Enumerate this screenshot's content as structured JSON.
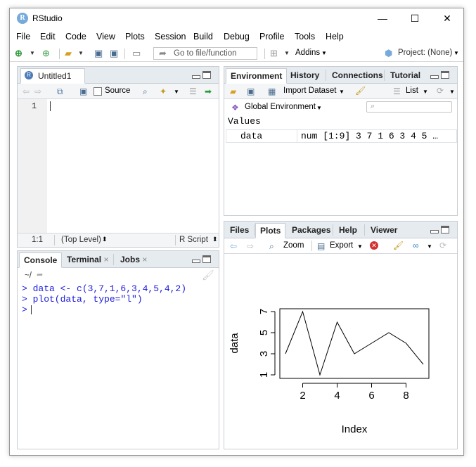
{
  "window": {
    "title": "RStudio",
    "minimize": "—",
    "maximize": "☐",
    "close": "✕",
    "logo_letter": "R"
  },
  "menu": [
    "File",
    "Edit",
    "Code",
    "View",
    "Plots",
    "Session",
    "Build",
    "Debug",
    "Profile",
    "Tools",
    "Help"
  ],
  "toolbar": {
    "goto_placeholder": "Go to file/function",
    "addins": "Addins",
    "project": "Project: (None)"
  },
  "editor": {
    "tab_label": "Untitled1",
    "source_label": "Source",
    "line_number": "1",
    "status_position": "1:1",
    "status_scope": "(Top Level)",
    "status_type": "R Script"
  },
  "console": {
    "tabs": [
      "Console",
      "Terminal",
      "Jobs"
    ],
    "path": "~/",
    "lines": [
      "> data <- c(3,7,1,6,3,4,5,4,2)",
      "> plot(data, type=\"l\")",
      ">"
    ]
  },
  "environment": {
    "tabs": [
      "Environment",
      "History",
      "Connections",
      "Tutorial"
    ],
    "import_label": "Import Dataset",
    "list_label": "List",
    "scope_label": "Global Environment",
    "section_label": "Values",
    "rows": [
      {
        "name": "data",
        "value": "num [1:9] 3 7 1 6 3 4 5 …"
      }
    ]
  },
  "files": {
    "tabs": [
      "Files",
      "Plots",
      "Packages",
      "Help",
      "Viewer"
    ],
    "zoom_label": "Zoom",
    "export_label": "Export"
  },
  "chart_data": {
    "type": "line",
    "x": [
      1,
      2,
      3,
      4,
      5,
      6,
      7,
      8,
      9
    ],
    "values": [
      3,
      7,
      1,
      6,
      3,
      4,
      5,
      4,
      2
    ],
    "xlabel": "Index",
    "ylabel": "data",
    "xticks": [
      "2",
      "4",
      "6",
      "8"
    ],
    "yticks": [
      "1",
      "3",
      "5",
      "7"
    ],
    "xlim": [
      1,
      9
    ],
    "ylim": [
      1,
      7
    ],
    "grid": false
  }
}
